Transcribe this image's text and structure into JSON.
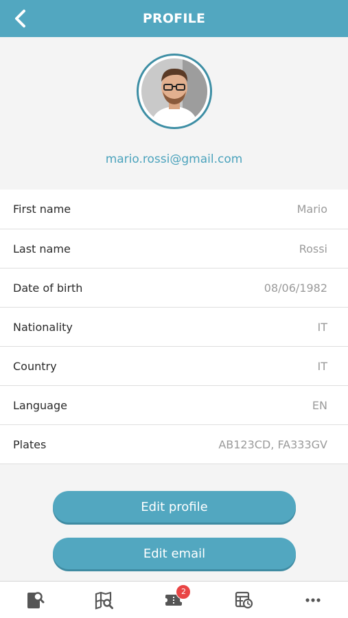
{
  "header": {
    "title": "PROFILE",
    "back_icon": "chevron-left-icon"
  },
  "profile": {
    "email": "mario.rossi@gmail.com"
  },
  "fields": [
    {
      "label": "First name",
      "value": "Mario"
    },
    {
      "label": "Last name",
      "value": "Rossi"
    },
    {
      "label": "Date of birth",
      "value": "08/06/1982"
    },
    {
      "label": "Nationality",
      "value": "IT"
    },
    {
      "label": "Country",
      "value": "IT"
    },
    {
      "label": "Language",
      "value": "EN"
    },
    {
      "label": "Plates",
      "value": "AB123CD, FA333GV"
    }
  ],
  "buttons": {
    "edit_profile": "Edit profile",
    "edit_email": "Edit email"
  },
  "tabbar": {
    "items": [
      {
        "icon": "document-search-icon"
      },
      {
        "icon": "map-search-icon"
      },
      {
        "icon": "ticket-icon",
        "badge": "2"
      },
      {
        "icon": "schedule-icon"
      },
      {
        "icon": "more-icon"
      }
    ]
  },
  "colors": {
    "accent": "#52a7c0",
    "badge": "#e94545"
  }
}
